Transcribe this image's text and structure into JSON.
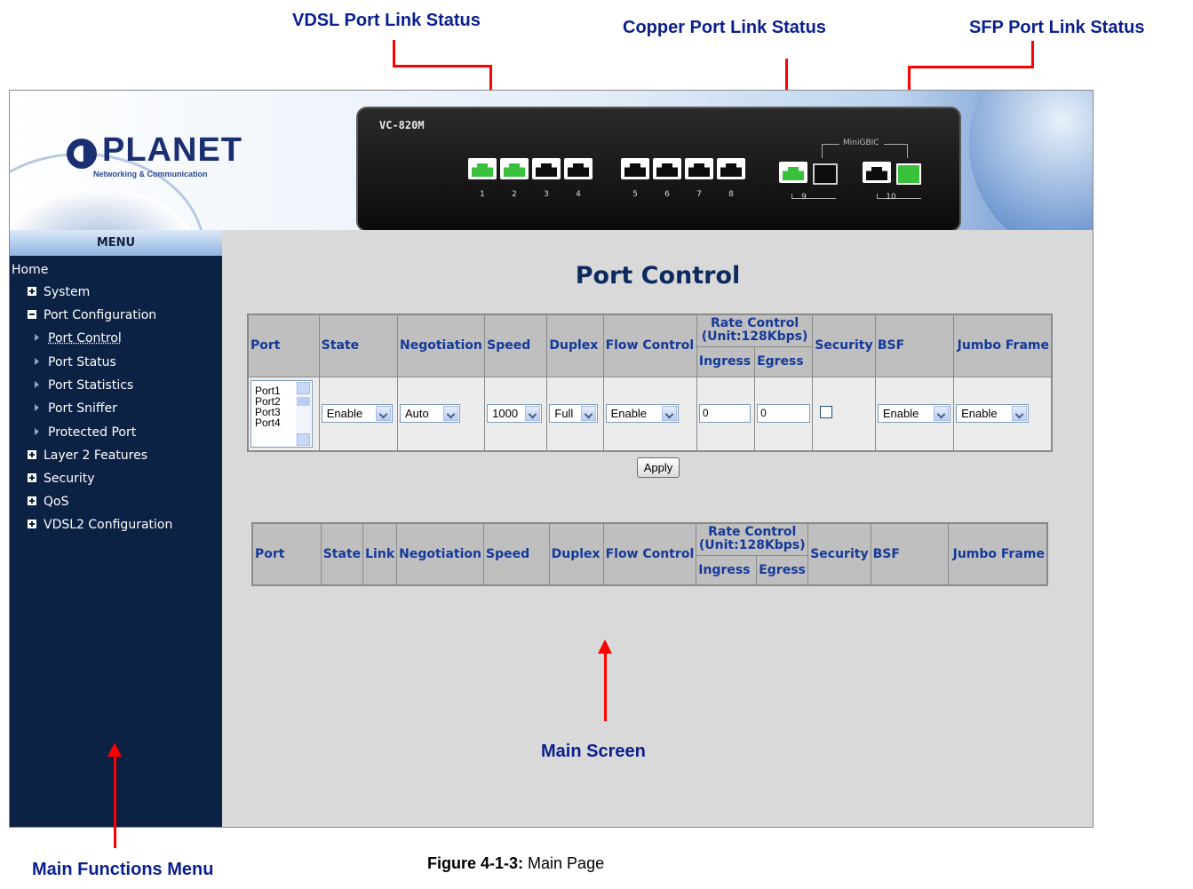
{
  "annotations": {
    "vdsl_status": "VDSL Port Link Status",
    "copper_status": "Copper Port Link Status",
    "sfp_status": "SFP Port Link Status",
    "main_screen": "Main Screen",
    "main_menu": "Main Functions Menu"
  },
  "caption": {
    "label": "Figure 4-1-3:",
    "text": " Main Page"
  },
  "banner": {
    "brand": "PLANET",
    "tagline": "Networking & Communication",
    "device_model": "VC-820M",
    "port_numbers": [
      "1",
      "2",
      "3",
      "4",
      "5",
      "6",
      "7",
      "8"
    ],
    "lit_ports": [
      "1",
      "2"
    ],
    "minigbic_label": "MiniGBIC",
    "copper_port_label": "9",
    "sfp_port_label": "10"
  },
  "menu": {
    "header": "MENU",
    "home": "Home",
    "items": [
      {
        "label": "System",
        "icon": "plus-box-icon"
      },
      {
        "label": "Port Configuration",
        "icon": "minus-box-icon"
      },
      {
        "label": "Port Control",
        "icon": "triangle-icon",
        "active": true
      },
      {
        "label": "Port Status",
        "icon": "triangle-icon"
      },
      {
        "label": "Port Statistics",
        "icon": "triangle-icon"
      },
      {
        "label": "Port Sniffer",
        "icon": "triangle-icon"
      },
      {
        "label": "Protected Port",
        "icon": "triangle-icon"
      },
      {
        "label": "Layer 2 Features",
        "icon": "plus-box-icon"
      },
      {
        "label": "Security",
        "icon": "plus-box-icon"
      },
      {
        "label": "QoS",
        "icon": "plus-box-icon"
      },
      {
        "label": "VDSL2 Configuration",
        "icon": "plus-box-icon"
      }
    ]
  },
  "main": {
    "title": "Port Control",
    "config_table": {
      "headers": {
        "port": "Port",
        "state": "State",
        "negotiation": "Negotiation",
        "speed": "Speed",
        "duplex": "Duplex",
        "flow_control": "Flow Control",
        "rate_control": "Rate Control",
        "rate_unit": "(Unit:128Kbps)",
        "ingress": "Ingress",
        "egress": "Egress",
        "security": "Security",
        "bsf": "BSF",
        "jumbo_frame": "Jumbo Frame"
      },
      "port_list": [
        "Port1",
        "Port2",
        "Port3",
        "Port4"
      ],
      "values": {
        "state": "Enable",
        "negotiation": "Auto",
        "speed": "1000",
        "duplex": "Full",
        "flow_control": "Enable",
        "ingress": "0",
        "egress": "0",
        "security_checked": false,
        "bsf": "Enable",
        "jumbo_frame": "Enable"
      },
      "apply_label": "Apply"
    },
    "status_table": {
      "headers": {
        "port": "Port",
        "state": "State",
        "link": "Link",
        "negotiation": "Negotiation",
        "speed": "Speed",
        "duplex": "Duplex",
        "flow_control": "Flow Control",
        "rate_control": "Rate Control",
        "rate_unit": "(Unit:128Kbps)",
        "ingress": "Ingress",
        "egress": "Egress",
        "security": "Security",
        "bsf": "BSF",
        "jumbo_frame": "Jumbo Frame"
      }
    }
  },
  "colors": {
    "annotation": "#0a1f8f",
    "arrow": "#ff0000",
    "menu_bg": "#0b2245",
    "header_text": "#14399a"
  }
}
